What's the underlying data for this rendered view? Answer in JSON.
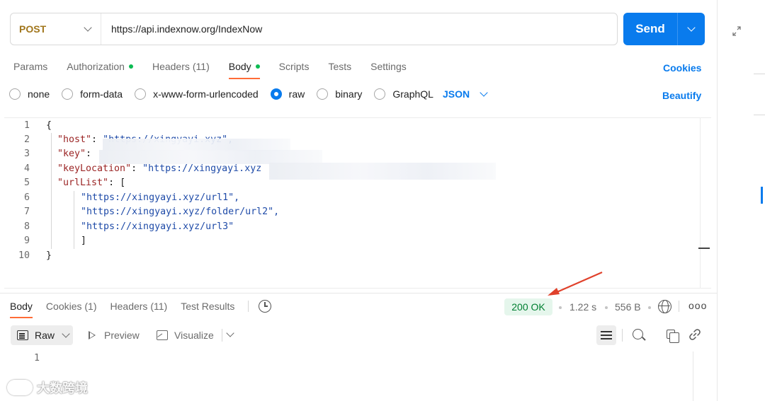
{
  "request": {
    "method": "POST",
    "url": "https://api.indexnow.org/IndexNow",
    "send_label": "Send"
  },
  "tabs": [
    {
      "label": "Params",
      "count": "",
      "dot": false,
      "active": false
    },
    {
      "label": "Authorization",
      "count": "",
      "dot": true,
      "active": false
    },
    {
      "label": "Headers",
      "count": "(11)",
      "dot": false,
      "active": false
    },
    {
      "label": "Body",
      "count": "",
      "dot": true,
      "active": true
    },
    {
      "label": "Scripts",
      "count": "",
      "dot": false,
      "active": false
    },
    {
      "label": "Tests",
      "count": "",
      "dot": false,
      "active": false
    },
    {
      "label": "Settings",
      "count": "",
      "dot": false,
      "active": false
    }
  ],
  "cookies_label": "Cookies",
  "body_types": [
    {
      "label": "none",
      "checked": false
    },
    {
      "label": "form-data",
      "checked": false
    },
    {
      "label": "x-www-form-urlencoded",
      "checked": false
    },
    {
      "label": "raw",
      "checked": true
    },
    {
      "label": "binary",
      "checked": false
    },
    {
      "label": "GraphQL",
      "checked": false
    }
  ],
  "body_format": "JSON",
  "beautify_label": "Beautify",
  "editor": {
    "line_numbers": [
      "1",
      "2",
      "3",
      "4",
      "5",
      "6",
      "7",
      "8",
      "9",
      "10"
    ],
    "l1": "{",
    "l2_key": "\"host\"",
    "l2_val": "\"https://xingyayi.xyz\",",
    "l3_key": "\"key\"",
    "l4_key": "\"keyLocation\"",
    "l4_val": "\"https://xingyayi.xyz",
    "l5_key": "\"urlList\"",
    "l5_val": "[",
    "l6": "\"https://xingyayi.xyz/url1\",",
    "l7": "\"https://xingyayi.xyz/folder/url2\",",
    "l8": "\"https://xingyayi.xyz/url3\"",
    "l9": "]",
    "l10": "}"
  },
  "response": {
    "tabs": [
      {
        "label": "Body",
        "active": true
      },
      {
        "label": "Cookies (1)",
        "active": false
      },
      {
        "label": "Headers (11)",
        "active": false
      },
      {
        "label": "Test Results",
        "active": false
      }
    ],
    "status": "200 OK",
    "time": "1.22 s",
    "size": "556 B",
    "more": "ooo",
    "view_mode": "Raw",
    "preview_label": "Preview",
    "visualize_label": "Visualize",
    "line_number": "1"
  },
  "watermark": "大数跨境",
  "colors": {
    "accent": "#097bed",
    "active_tab_underline": "#ff6c37",
    "status_bg": "#e5f6ec",
    "status_text": "#007f31",
    "method": "#a1761c",
    "annotation_arrow": "#e0412b"
  }
}
